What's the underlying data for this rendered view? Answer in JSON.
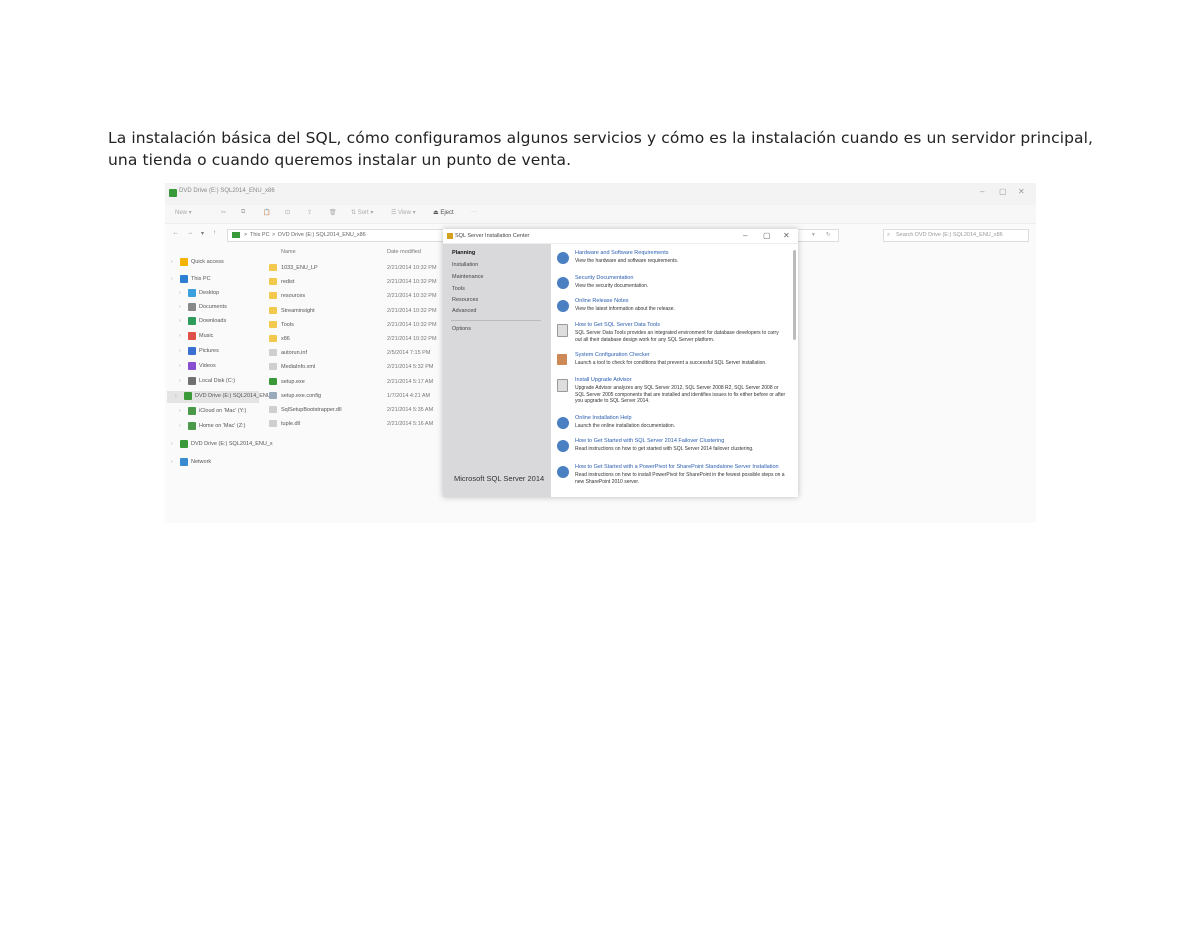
{
  "caption": "La instalación básica del SQL, cómo configuramos algunos servicios y cómo es la instalación cuando es un servidor principal, una tienda o cuando queremos instalar un punto de venta.",
  "explorer": {
    "title": "DVD Drive (E:) SQL2014_ENU_x86",
    "window_controls": {
      "minimize": "–",
      "maximize": "▢",
      "close": "✕"
    },
    "toolbar": {
      "new": "New ▾",
      "sort": "⇅ Sort ▾",
      "view": "☰ View ▾",
      "eject": "⏏ Eject",
      "more": "···"
    },
    "nav_buttons": {
      "back": "←",
      "forward": "→",
      "recent": "▾",
      "up": "↑"
    },
    "address": {
      "this_pc": "This PC",
      "sep": ">",
      "drive": "DVD Drive (E:) SQL2014_ENU_x86"
    },
    "address_right": {
      "dropdown": "▾",
      "refresh": "↻"
    },
    "search_placeholder": "Search DVD Drive (E:) SQL2014_ENU_x86",
    "nav_items": [
      {
        "label": "Quick access",
        "color": "#f2b400"
      },
      {
        "label": "This PC",
        "color": "#2d7fd3"
      },
      {
        "label": "Desktop",
        "color": "#3aa0e0"
      },
      {
        "label": "Documents",
        "color": "#888888"
      },
      {
        "label": "Downloads",
        "color": "#2d9c5c"
      },
      {
        "label": "Music",
        "color": "#e0504b"
      },
      {
        "label": "Pictures",
        "color": "#3a70d0"
      },
      {
        "label": "Videos",
        "color": "#8a4fd0"
      },
      {
        "label": "Local Disk (C:)",
        "color": "#707070"
      },
      {
        "label": "DVD Drive (E:) SQL2014_ENU",
        "color": "#3a9a3a"
      },
      {
        "label": "iCloud on 'Mac' (Y:)",
        "color": "#4a9a4a"
      },
      {
        "label": "Home on 'Mac' (Z:)",
        "color": "#4a9a4a"
      },
      {
        "label": "DVD Drive (E:) SQL2014_ENU_x",
        "color": "#3a9a3a"
      },
      {
        "label": "Network",
        "color": "#3a8ad0"
      }
    ],
    "columns": {
      "name": "Name",
      "date": "Date modified"
    },
    "files": [
      {
        "name": "1033_ENU_LP",
        "date": "2/21/2014 10:32 PM",
        "color": "#f2c94c"
      },
      {
        "name": "redist",
        "date": "2/21/2014 10:32 PM",
        "color": "#f2c94c"
      },
      {
        "name": "resources",
        "date": "2/21/2014 10:32 PM",
        "color": "#f2c94c"
      },
      {
        "name": "Streaminsight",
        "date": "2/21/2014 10:32 PM",
        "color": "#f2c94c"
      },
      {
        "name": "Tools",
        "date": "2/21/2014 10:32 PM",
        "color": "#f2c94c"
      },
      {
        "name": "x86",
        "date": "2/21/2014 10:32 PM",
        "color": "#f2c94c"
      },
      {
        "name": "autorun.inf",
        "date": "2/5/2014 7:15 PM",
        "color": "#cfcfcf"
      },
      {
        "name": "MediaInfo.xml",
        "date": "2/21/2014 5:32 PM",
        "color": "#cfcfcf"
      },
      {
        "name": "setup.exe",
        "date": "2/21/2014 5:17 AM",
        "color": "#3a9a3a"
      },
      {
        "name": "setup.exe.config",
        "date": "1/7/2014 4:21 AM",
        "color": "#9ab"
      },
      {
        "name": "SqlSetupBootstrapper.dll",
        "date": "2/21/2014 5:35 AM",
        "color": "#cfcfcf"
      },
      {
        "name": "tuple.dll",
        "date": "2/21/2014 5:16 AM",
        "color": "#cfcfcf"
      }
    ]
  },
  "sql": {
    "title": "SQL Server Installation Center",
    "window_controls": {
      "minimize": "–",
      "maximize": "▢",
      "close": "✕"
    },
    "side_items": [
      "Planning",
      "Installation",
      "Maintenance",
      "Tools",
      "Resources",
      "Advanced",
      "Options"
    ],
    "brand": "Microsoft SQL Server 2014",
    "entries": [
      {
        "title": "Hardware and Software Requirements",
        "desc": "View the hardware and software requirements.",
        "icon": "help"
      },
      {
        "title": "Security Documentation",
        "desc": "View the security documentation.",
        "icon": "help"
      },
      {
        "title": "Online Release Notes",
        "desc": "View the latest information about the release.",
        "icon": "help"
      },
      {
        "title": "How to Get SQL Server Data Tools",
        "desc": "SQL Server Data Tools provides an integrated environment for database developers to carry out all their database design work for any SQL Server platform.",
        "icon": "doc"
      },
      {
        "title": "System Configuration Checker",
        "desc": "Launch a tool to check for conditions that prevent a successful SQL Server installation.",
        "icon": "tool"
      },
      {
        "title": "Install Upgrade Advisor",
        "desc": "Upgrade Advisor analyzes any SQL Server 2012, SQL Server 2008 R2, SQL Server 2008 or SQL Server 2005 components that are installed and identifies issues to fix either before or after you upgrade to SQL Server 2014.",
        "icon": "doc"
      },
      {
        "title": "Online Installation Help",
        "desc": "Launch the online installation documentation.",
        "icon": "help"
      },
      {
        "title": "How to Get Started with SQL Server 2014 Failover Clustering",
        "desc": "Read instructions on how to get started with SQL Server 2014 failover clustering.",
        "icon": "help"
      },
      {
        "title": "How to Get Started with a PowerPivot for SharePoint Standalone Server Installation",
        "desc": "Read instructions on how to install PowerPivot for SharePoint in the fewest possible steps on a new SharePoint 2010 server.",
        "icon": "help"
      }
    ]
  }
}
